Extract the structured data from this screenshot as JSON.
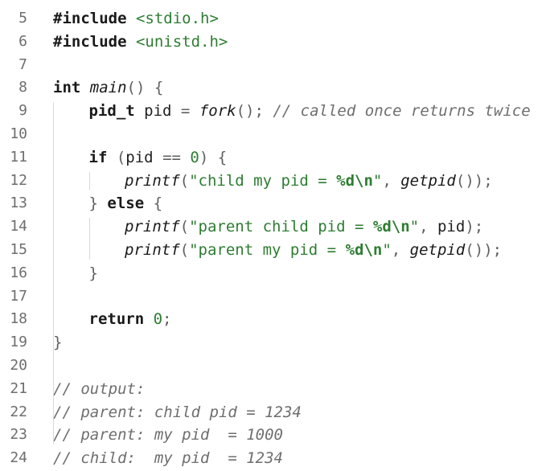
{
  "editor": {
    "lines": [
      {
        "num": "5",
        "indent": 0,
        "tokens": [
          {
            "t": "#include",
            "c": "kw"
          },
          {
            "t": " ",
            "c": ""
          },
          {
            "t": "<stdio.h>",
            "c": "str"
          }
        ]
      },
      {
        "num": "6",
        "indent": 0,
        "tokens": [
          {
            "t": "#include",
            "c": "kw"
          },
          {
            "t": " ",
            "c": ""
          },
          {
            "t": "<unistd.h>",
            "c": "str"
          }
        ]
      },
      {
        "num": "7",
        "indent": 0,
        "tokens": []
      },
      {
        "num": "8",
        "indent": 0,
        "tokens": [
          {
            "t": "int",
            "c": "kw"
          },
          {
            "t": " ",
            "c": ""
          },
          {
            "t": "main",
            "c": "fn"
          },
          {
            "t": "()",
            "c": "pn"
          },
          {
            "t": " ",
            "c": ""
          },
          {
            "t": "{",
            "c": "pn"
          }
        ]
      },
      {
        "num": "9",
        "indent": 1,
        "tokens": [
          {
            "t": "pid_t",
            "c": "ty"
          },
          {
            "t": " pid ",
            "c": ""
          },
          {
            "t": "=",
            "c": "op"
          },
          {
            "t": " ",
            "c": ""
          },
          {
            "t": "fork",
            "c": "fn"
          },
          {
            "t": "();",
            "c": "pn"
          },
          {
            "t": " ",
            "c": ""
          },
          {
            "t": "// called once returns twice",
            "c": "cm"
          }
        ]
      },
      {
        "num": "10",
        "indent": 0,
        "tokens": []
      },
      {
        "num": "11",
        "indent": 1,
        "tokens": [
          {
            "t": "if",
            "c": "kw"
          },
          {
            "t": " ",
            "c": ""
          },
          {
            "t": "(",
            "c": "pn"
          },
          {
            "t": "pid ",
            "c": ""
          },
          {
            "t": "==",
            "c": "op"
          },
          {
            "t": " ",
            "c": ""
          },
          {
            "t": "0",
            "c": "num"
          },
          {
            "t": ")",
            "c": "pn"
          },
          {
            "t": " ",
            "c": ""
          },
          {
            "t": "{",
            "c": "pn"
          }
        ]
      },
      {
        "num": "12",
        "indent": 2,
        "tokens": [
          {
            "t": "printf",
            "c": "fn"
          },
          {
            "t": "(",
            "c": "pn"
          },
          {
            "t": "\"child my pid = ",
            "c": "str"
          },
          {
            "t": "%d\\n",
            "c": "esc"
          },
          {
            "t": "\"",
            "c": "str"
          },
          {
            "t": ", ",
            "c": "pn"
          },
          {
            "t": "getpid",
            "c": "fn"
          },
          {
            "t": "());",
            "c": "pn"
          }
        ]
      },
      {
        "num": "13",
        "indent": 1,
        "tokens": [
          {
            "t": "}",
            "c": "pn"
          },
          {
            "t": " ",
            "c": ""
          },
          {
            "t": "else",
            "c": "kw"
          },
          {
            "t": " ",
            "c": ""
          },
          {
            "t": "{",
            "c": "pn"
          }
        ]
      },
      {
        "num": "14",
        "indent": 2,
        "tokens": [
          {
            "t": "printf",
            "c": "fn"
          },
          {
            "t": "(",
            "c": "pn"
          },
          {
            "t": "\"parent child pid = ",
            "c": "str"
          },
          {
            "t": "%d\\n",
            "c": "esc"
          },
          {
            "t": "\"",
            "c": "str"
          },
          {
            "t": ", ",
            "c": "pn"
          },
          {
            "t": "pid",
            "c": ""
          },
          {
            "t": ");",
            "c": "pn"
          }
        ]
      },
      {
        "num": "15",
        "indent": 2,
        "tokens": [
          {
            "t": "printf",
            "c": "fn"
          },
          {
            "t": "(",
            "c": "pn"
          },
          {
            "t": "\"parent my pid = ",
            "c": "str"
          },
          {
            "t": "%d\\n",
            "c": "esc"
          },
          {
            "t": "\"",
            "c": "str"
          },
          {
            "t": ", ",
            "c": "pn"
          },
          {
            "t": "getpid",
            "c": "fn"
          },
          {
            "t": "());",
            "c": "pn"
          }
        ]
      },
      {
        "num": "16",
        "indent": 1,
        "tokens": [
          {
            "t": "}",
            "c": "pn"
          }
        ]
      },
      {
        "num": "17",
        "indent": 0,
        "tokens": []
      },
      {
        "num": "18",
        "indent": 1,
        "tokens": [
          {
            "t": "return",
            "c": "kw"
          },
          {
            "t": " ",
            "c": ""
          },
          {
            "t": "0",
            "c": "num"
          },
          {
            "t": ";",
            "c": "pn"
          }
        ]
      },
      {
        "num": "19",
        "indent": 0,
        "tokens": [
          {
            "t": "}",
            "c": "pn"
          }
        ]
      },
      {
        "num": "20",
        "indent": 0,
        "tokens": []
      },
      {
        "num": "21",
        "indent": 0,
        "tokens": [
          {
            "t": "// output:",
            "c": "cm"
          }
        ]
      },
      {
        "num": "22",
        "indent": 0,
        "tokens": [
          {
            "t": "// parent: child pid = 1234",
            "c": "cm"
          }
        ]
      },
      {
        "num": "23",
        "indent": 0,
        "tokens": [
          {
            "t": "// parent: my pid  = 1000",
            "c": "cm"
          }
        ]
      },
      {
        "num": "24",
        "indent": 0,
        "tokens": [
          {
            "t": "// child:  my pid  = 1234",
            "c": "cm"
          }
        ]
      }
    ]
  }
}
